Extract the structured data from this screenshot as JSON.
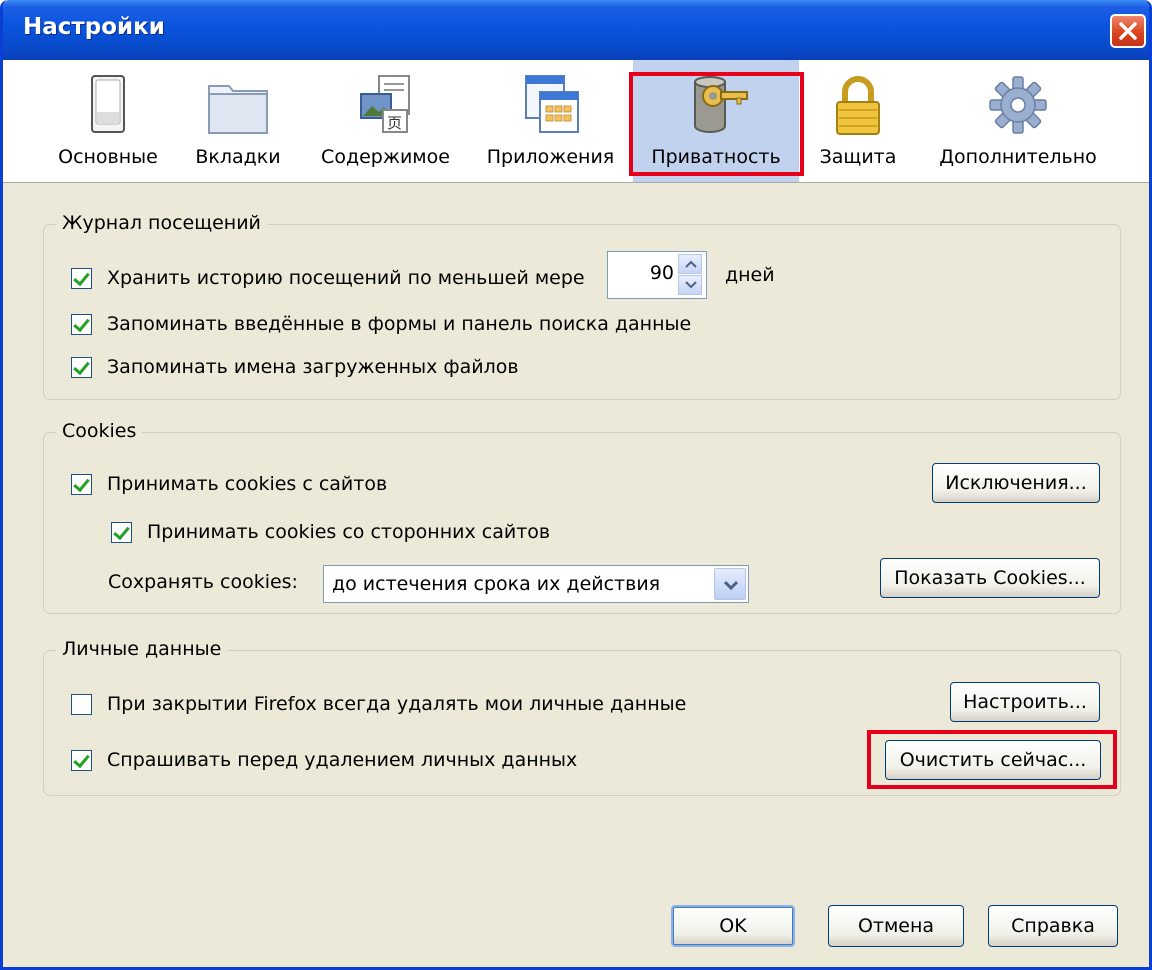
{
  "window": {
    "title": "Настройки"
  },
  "tabs": [
    {
      "label": "Основные",
      "icon": "switch-icon"
    },
    {
      "label": "Вкладки",
      "icon": "folder-tabs-icon"
    },
    {
      "label": "Содержимое",
      "icon": "content-icon"
    },
    {
      "label": "Приложения",
      "icon": "applications-icon"
    },
    {
      "label": "Приватность",
      "icon": "privacy-key-icon",
      "selected": true
    },
    {
      "label": "Защита",
      "icon": "padlock-icon"
    },
    {
      "label": "Дополнительно",
      "icon": "gear-icon"
    }
  ],
  "history": {
    "legend": "Журнал посещений",
    "keep_history": {
      "label": "Хранить историю посещений по меньшей мере",
      "checked": true
    },
    "days_value": "90",
    "days_unit": "дней",
    "remember_forms": {
      "label": "Запоминать введённые в формы и панель поиска данные",
      "checked": true
    },
    "remember_downloads": {
      "label": "Запоминать имена загруженных файлов",
      "checked": true
    }
  },
  "cookies": {
    "legend": "Cookies",
    "accept": {
      "label": "Принимать cookies с сайтов",
      "checked": true
    },
    "accept_third_party": {
      "label": "Принимать cookies со сторонних сайтов",
      "checked": true
    },
    "keep_label": "Сохранять cookies:",
    "keep_value": "до истечения срока их действия",
    "exceptions_button": "Исключения...",
    "show_cookies_button": "Показать Cookies..."
  },
  "private_data": {
    "legend": "Личные данные",
    "clear_on_close": {
      "label": "При закрытии Firefox всегда удалять мои личные данные",
      "checked": false
    },
    "ask_before": {
      "label": "Спрашивать перед удалением личных данных",
      "checked": true
    },
    "settings_button": "Настроить...",
    "clear_now_button": "Очистить сейчас..."
  },
  "footer": {
    "ok": "OK",
    "cancel": "Отмена",
    "help": "Справка"
  },
  "colors": {
    "title_bar": "#0a54dd",
    "dialog_bg": "#ece9d8",
    "selected_tab": "#c1d2ee",
    "highlight": "#e8001a",
    "check": "#21a121"
  }
}
